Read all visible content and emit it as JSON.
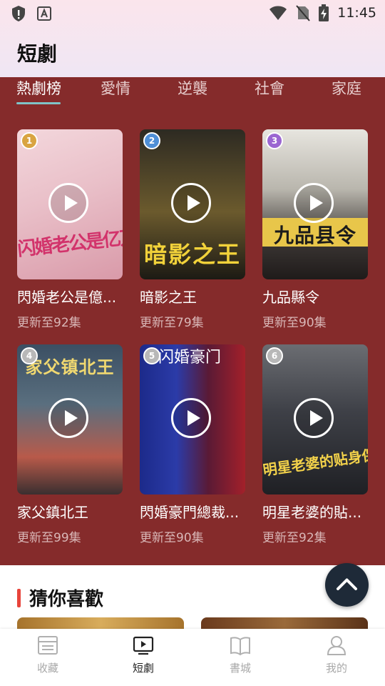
{
  "status_bar": {
    "time": "11:45",
    "left_icons": [
      "shield-icon",
      "a-icon"
    ],
    "right_icons": [
      "wifi-icon",
      "no-sim-icon",
      "battery-charging-icon"
    ]
  },
  "header": {
    "title": "短劇"
  },
  "tabs": [
    {
      "label": "熱劇榜",
      "active": true
    },
    {
      "label": "愛情",
      "active": false
    },
    {
      "label": "逆襲",
      "active": false
    },
    {
      "label": "社會",
      "active": false
    },
    {
      "label": "家庭",
      "active": false
    }
  ],
  "dramas": [
    {
      "rank": "1",
      "title": "閃婚老公是億萬富翁",
      "title_display": "閃婚老公是億...",
      "update": "更新至92集",
      "cover_text": "闪婚老公是亿万富翁",
      "rank_color": "#d9a441"
    },
    {
      "rank": "2",
      "title": "暗影之王",
      "title_display": "暗影之王",
      "update": "更新至79集",
      "cover_text": "暗影之王",
      "rank_color": "#4f8fd6"
    },
    {
      "rank": "3",
      "title": "九品縣令",
      "title_display": "九品縣令",
      "update": "更新至90集",
      "cover_text": "九品县令",
      "rank_color": "#9b66d1"
    },
    {
      "rank": "4",
      "title": "家父鎮北王",
      "title_display": "家父鎮北王",
      "update": "更新至99集",
      "cover_text": "家父镇北王",
      "rank_color": "#b8b8b8"
    },
    {
      "rank": "5",
      "title": "閃婚豪門總裁",
      "title_display": "閃婚豪門總裁...",
      "update": "更新至90集",
      "cover_text": "闪婚豪门",
      "rank_color": "#b8b8b8"
    },
    {
      "rank": "6",
      "title": "明星老婆的貼身保鏢",
      "title_display": "明星老婆的貼...",
      "update": "更新至92集",
      "cover_text": "明星老婆的贴身保镖",
      "rank_color": "#b8b8b8"
    }
  ],
  "recommend": {
    "title": "猜你喜歡"
  },
  "bottom_nav": [
    {
      "label": "收藏",
      "icon": "list-icon",
      "active": false
    },
    {
      "label": "短劇",
      "icon": "play-screen-icon",
      "active": true
    },
    {
      "label": "書城",
      "icon": "book-icon",
      "active": false
    },
    {
      "label": "我的",
      "icon": "person-icon",
      "active": false
    }
  ],
  "colors": {
    "panel": "#852b2b",
    "tab_underline": "#7fc4c8",
    "accent": "#e8443b",
    "fab": "#1e2a38"
  }
}
